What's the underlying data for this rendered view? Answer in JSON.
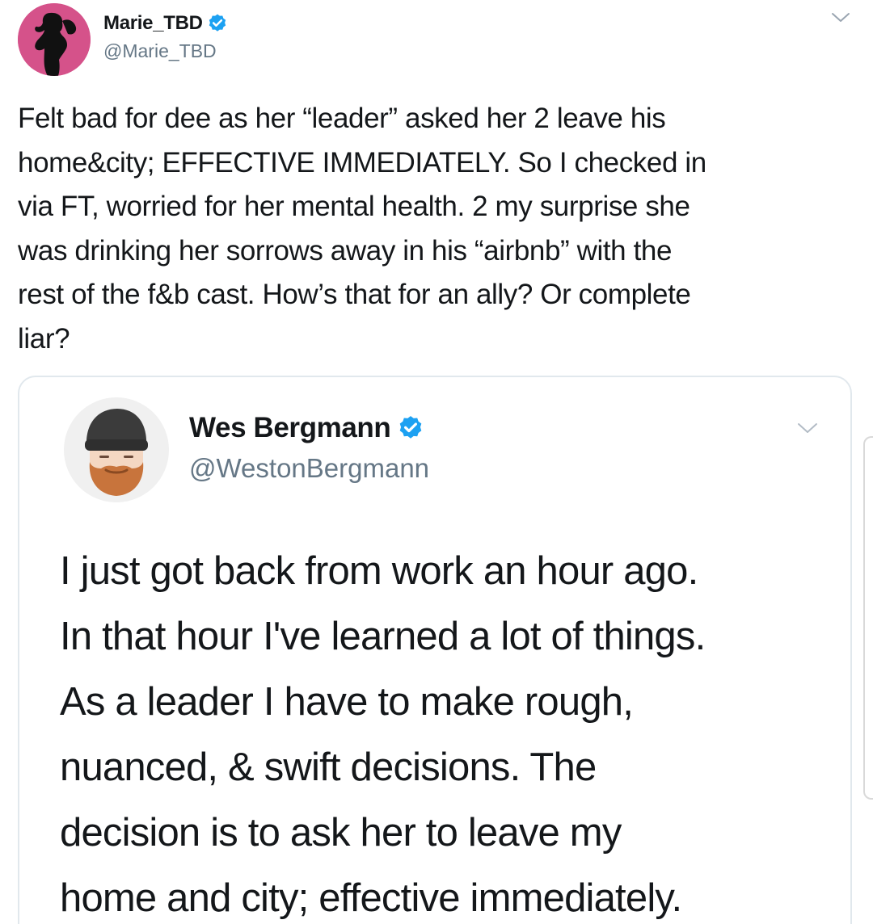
{
  "colors": {
    "verified_blue": "#1da1f2",
    "handle_gray": "#657786",
    "text_dark": "#14171a",
    "card_border": "#e1e8ed",
    "avatar_pink": "#d5528a"
  },
  "outer_tweet": {
    "display_name": "Marie_TBD",
    "handle": "@Marie_TBD",
    "avatar_icon": "silhouette-avatar",
    "verified_icon": "verified-badge-icon",
    "menu_icon": "chevron-down-icon",
    "text": "Felt bad for dee as her “leader” asked her 2 leave his\nhome&city; EFFECTIVE IMMEDIATELY. So I checked in\nvia FT, worried for her mental health. 2 my surprise she\nwas drinking her sorrows away in his “airbnb” with the\nrest of the f&b cast. How’s that for an ally? Or complete\nliar?"
  },
  "quoted_tweet": {
    "display_name": "Wes Bergmann",
    "handle": "@WestonBergmann",
    "avatar_icon": "bearded-man-avatar",
    "verified_icon": "verified-badge-icon",
    "menu_icon": "chevron-down-icon",
    "text": "I just got back from work an hour ago.\nIn that hour I've learned a lot of things.\nAs a leader I have to make rough,\nnuanced, & swift decisions. The\ndecision is to ask her to leave my\nhome and city; effective immediately."
  }
}
